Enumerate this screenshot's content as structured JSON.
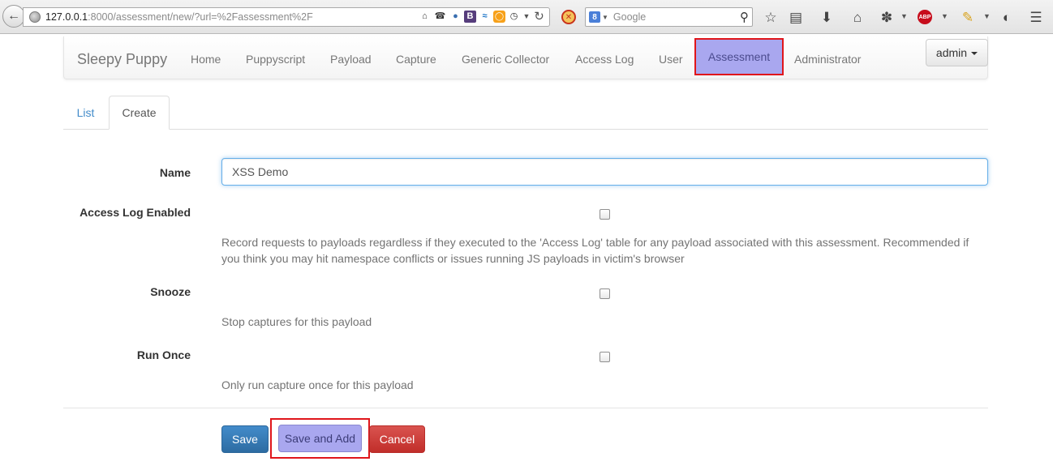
{
  "browser": {
    "url_host": "127.0.0.1",
    "url_rest": ":8000/assessment/new/?url=%2Fassessment%2F",
    "search_placeholder": "Google",
    "search_engine_badge": "8",
    "abp_label": "ABP",
    "bootstrap_icon_label": "B"
  },
  "navbar": {
    "brand": "Sleepy Puppy",
    "items": [
      {
        "label": "Home"
      },
      {
        "label": "Puppyscript"
      },
      {
        "label": "Payload"
      },
      {
        "label": "Capture"
      },
      {
        "label": "Generic Collector"
      },
      {
        "label": "Access Log"
      },
      {
        "label": "User"
      },
      {
        "label": "Assessment",
        "active": true
      },
      {
        "label": "Administrator"
      }
    ],
    "user_menu": "admin"
  },
  "tabs": [
    {
      "label": "List"
    },
    {
      "label": "Create",
      "active": true
    }
  ],
  "form": {
    "name": {
      "label": "Name",
      "value": "XSS Demo"
    },
    "access_log": {
      "label": "Access Log Enabled",
      "checked": false,
      "help": "Record requests to payloads regardless if they executed to the 'Access Log' table for any payload associated with this assessment. Recommended if you think you may hit namespace conflicts or issues running JS payloads in victim's browser"
    },
    "snooze": {
      "label": "Snooze",
      "checked": false,
      "help": "Stop captures for this payload"
    },
    "run_once": {
      "label": "Run Once",
      "checked": false,
      "help": "Only run capture once for this payload"
    }
  },
  "buttons": {
    "save": "Save",
    "save_and_add": "Save and Add",
    "cancel": "Cancel"
  },
  "colors": {
    "highlight": "#a9a7ef",
    "highlight_border": "#e0161b",
    "primary": "#428bca",
    "danger": "#d9534f"
  }
}
